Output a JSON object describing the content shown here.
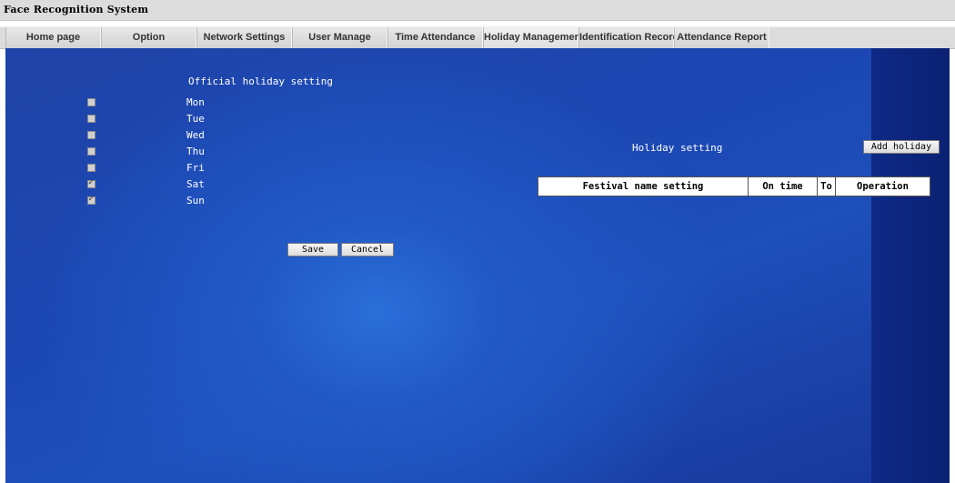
{
  "app": {
    "title": "Face Recognition System"
  },
  "nav": {
    "tabs": [
      {
        "label": "Home page"
      },
      {
        "label": "Option"
      },
      {
        "label": "Network Settings"
      },
      {
        "label": "User Manage"
      },
      {
        "label": "Time Attendance"
      },
      {
        "label": "Holiday Management"
      },
      {
        "label": "Identification Record"
      },
      {
        "label": "Attendance Report"
      }
    ],
    "active": "Holiday Management"
  },
  "official": {
    "heading": "Official holiday setting",
    "days": [
      {
        "label": "Mon",
        "checked": false
      },
      {
        "label": "Tue",
        "checked": false
      },
      {
        "label": "Wed",
        "checked": false
      },
      {
        "label": "Thu",
        "checked": false
      },
      {
        "label": "Fri",
        "checked": false
      },
      {
        "label": "Sat",
        "checked": true
      },
      {
        "label": "Sun",
        "checked": true
      }
    ],
    "save_label": "Save",
    "cancel_label": "Cancel"
  },
  "holiday": {
    "heading": "Holiday setting",
    "add_label": "Add holiday",
    "columns": [
      "Festival name setting",
      "On time",
      "To",
      "Operation"
    ]
  },
  "colors": {
    "background": "#1e4fba",
    "text": "#ffffff",
    "nav_bg": "#dcdcdc"
  }
}
